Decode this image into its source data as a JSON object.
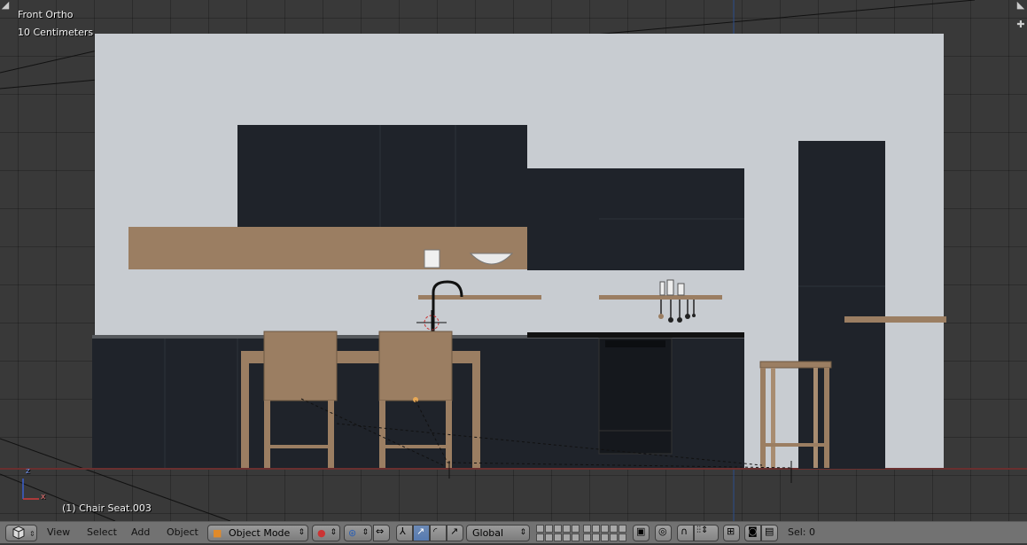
{
  "viewport": {
    "view_name": "Front Ortho",
    "grid_scale": "10 Centimeters",
    "active_object": "(1) Chair Seat.003",
    "axis_label_x": "x",
    "axis_label_z": "z"
  },
  "header": {
    "editor_type_icon": "3d-view-icon",
    "menus": {
      "view": "View",
      "select": "Select",
      "add": "Add",
      "object": "Object"
    },
    "mode": "Object Mode",
    "orientation": "Global",
    "selection_count": "Sel: 0"
  },
  "colors": {
    "viewport_bg": "#393939",
    "wall": "#c8ccd1",
    "cabinet": "#1f232a",
    "wood": "#9b7e62",
    "header_bg": "#727272",
    "active_button": "#5a7db2"
  }
}
